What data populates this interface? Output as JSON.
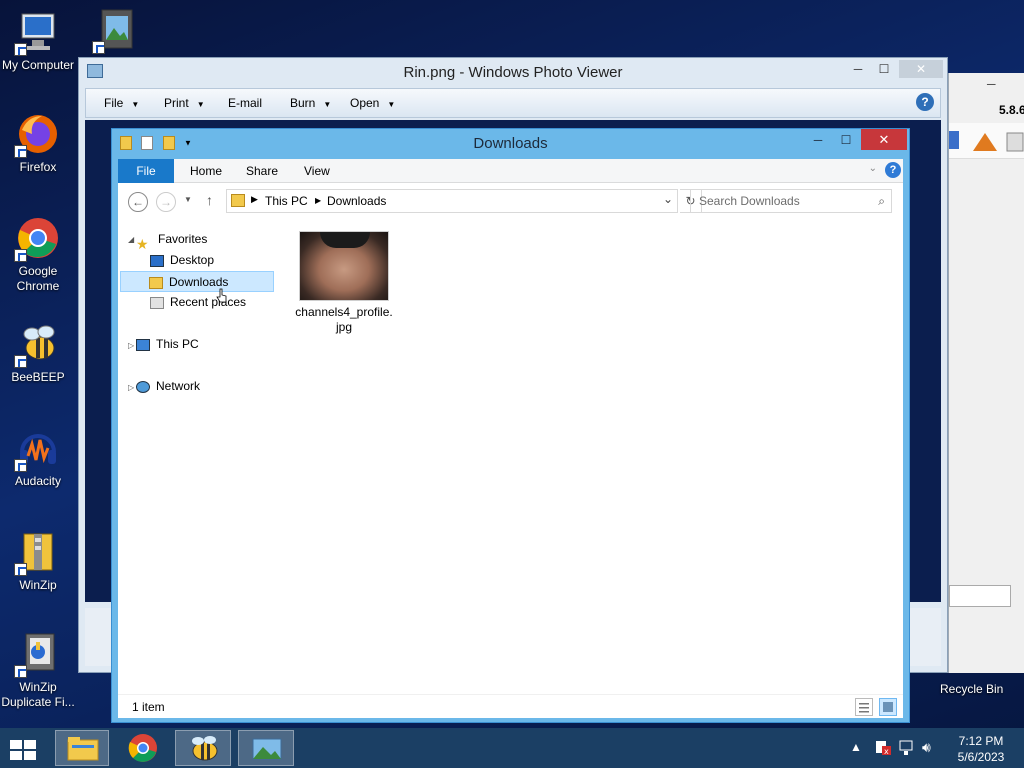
{
  "desktop": {
    "icons": [
      {
        "label": "My Computer"
      },
      {
        "label": "Firefox"
      },
      {
        "label": "Google Chrome"
      },
      {
        "label": "BeeBEEP"
      },
      {
        "label": "Audacity"
      },
      {
        "label": "WinZip"
      },
      {
        "label": "WinZip Duplicate Fi..."
      }
    ],
    "recycle_bin": "Recycle Bin"
  },
  "background_app": {
    "version_fragment": "5.8.6"
  },
  "photo_viewer": {
    "title": "Rin.png - Windows Photo Viewer",
    "menu": [
      "File",
      "Print",
      "E-mail",
      "Burn",
      "Open"
    ]
  },
  "explorer": {
    "title": "Downloads",
    "ribbon_tabs": [
      "File",
      "Home",
      "Share",
      "View"
    ],
    "breadcrumb": [
      "This PC",
      "Downloads"
    ],
    "search_placeholder": "Search Downloads",
    "nav": {
      "favorites": "Favorites",
      "desktop": "Desktop",
      "downloads": "Downloads",
      "recent": "Recent places",
      "this_pc": "This PC",
      "network": "Network"
    },
    "files": [
      {
        "name": "channels4_profile.jpg"
      }
    ],
    "status": "1 item"
  },
  "taskbar": {
    "time": "7:12 PM",
    "date": "5/6/2023"
  }
}
